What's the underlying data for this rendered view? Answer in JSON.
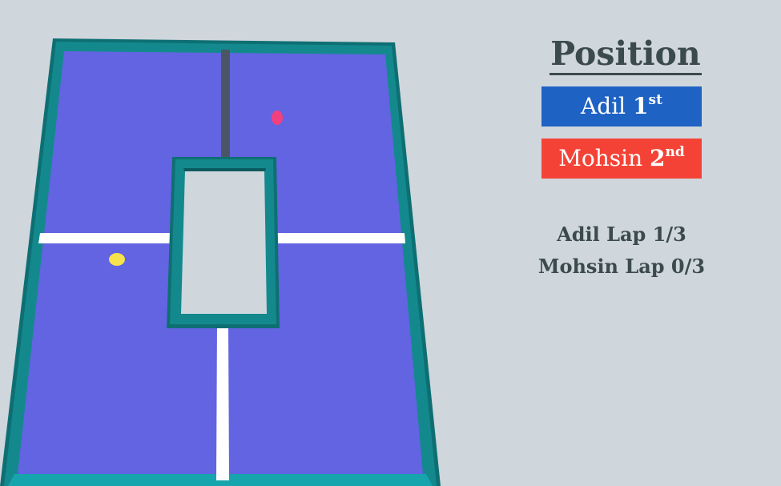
{
  "hud": {
    "position_title": "Position",
    "standings": [
      {
        "name": "Adil",
        "place": "1",
        "suffix": "st",
        "color": "#1e62c4"
      },
      {
        "name": "Mohsin",
        "place": "2",
        "suffix": "nd",
        "color": "#f44336"
      }
    ],
    "laps": [
      {
        "text": "Adil Lap 1/3"
      },
      {
        "text": "Mohsin Lap 0/3"
      }
    ]
  },
  "scene": {
    "background_color": "#cfd6dc",
    "track_color": "#6264e2",
    "wall_color": "#11878b",
    "wall_dark_color": "#0e6b70",
    "finish_line_color": "#ffffff",
    "start_barrier_color": "#4a5566",
    "racers": [
      {
        "name": "Adil",
        "color": "#f6e24a"
      },
      {
        "name": "Mohsin",
        "color": "#f0407e"
      }
    ]
  }
}
